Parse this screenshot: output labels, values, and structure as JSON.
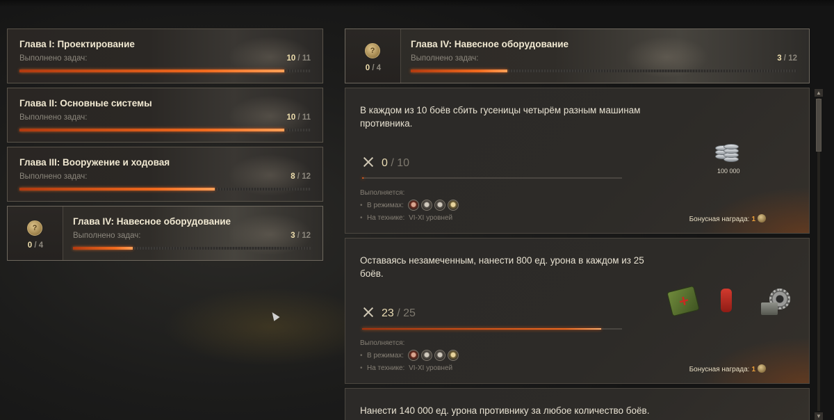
{
  "chapters": [
    {
      "title": "Глава I: Проектирование",
      "sub": "Выполнено задач:",
      "done": "10",
      "total": "11",
      "fraction": 0.91
    },
    {
      "title": "Глава II: Основные системы",
      "sub": "Выполнено задач:",
      "done": "10",
      "total": "11",
      "fraction": 0.91
    },
    {
      "title": "Глава III: Вооружение и ходовая",
      "sub": "Выполнено задач:",
      "done": "8",
      "total": "12",
      "fraction": 0.67
    },
    {
      "title": "Глава IV: Навесное оборудование",
      "sub": "Выполнено задач:",
      "done": "3",
      "total": "12",
      "fraction": 0.25,
      "badge_done": "0",
      "badge_total": "4"
    }
  ],
  "header": {
    "title": "Глава IV: Навесное оборудование",
    "sub": "Выполнено задач:",
    "done": "3",
    "total": "12",
    "fraction": 0.25,
    "badge_done": "0",
    "badge_total": "4"
  },
  "tasks": [
    {
      "description": "В каждом из 10 боёв сбить гусеницы четырём разным машинам противника.",
      "progress_done": "0",
      "progress_total": "10",
      "fraction": 0.0,
      "meta_title": "Выполняется:",
      "modes_label": "В режимах:",
      "tech_label": "На технике:",
      "tech_value": "VI-XI уровней",
      "bonus_label": "Бонусная награда:",
      "bonus_amount": "1",
      "reward_credits": "100 000"
    },
    {
      "description": "Оставаясь незамеченным, нанести 800 ед. урона в каждом из 25 боёв.",
      "progress_done": "23",
      "progress_total": "25",
      "fraction": 0.92,
      "meta_title": "Выполняется:",
      "modes_label": "В режимах:",
      "tech_label": "На технике:",
      "tech_value": "VI-XI уровней",
      "bonus_label": "Бонусная награда:",
      "bonus_amount": "1"
    },
    {
      "description": "Нанести 140 000 ед. урона противнику за любое количество боёв."
    }
  ],
  "icons": {
    "chapter_badge": "chapter-token-icon",
    "progress": "crossed-swords-icon",
    "modes": [
      "battle-mode-red-icon",
      "battle-mode-icon",
      "battle-mode-icon",
      "battle-mode-gold-icon"
    ],
    "rewards_task2": [
      "first-aid-kit-icon",
      "fire-extinguisher-icon",
      "equipment-gear-icon"
    ]
  },
  "colors": {
    "accent": "#f06a1e",
    "title": "#f1e9d2",
    "muted": "#8c877d",
    "bonus_amount": "#f0a23a"
  }
}
